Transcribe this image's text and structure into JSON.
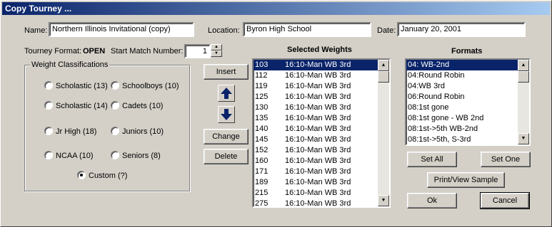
{
  "window": {
    "title": "Copy Tourney ..."
  },
  "header": {
    "name_label": "Name:",
    "name_value": "Northern Illinois Invitational (copy)",
    "location_label": "Location:",
    "location_value": "Byron High School",
    "date_label": "Date:",
    "date_value": "January 20, 2001"
  },
  "format": {
    "label": "Tourney Format:",
    "value": "OPEN",
    "start_label": "Start Match Number:",
    "start_value": "1"
  },
  "weight_group": {
    "title": "Weight Classifications",
    "options": [
      "Scholastic (13)",
      "Schoolboys (10)",
      "Scholastic (14)",
      "Cadets (10)",
      "Jr High (18)",
      "Juniors (10)",
      "NCAA (10)",
      "Seniors (8)",
      "Custom (?)"
    ],
    "selected": "Custom (?)"
  },
  "weight_buttons": {
    "insert": "Insert",
    "change": "Change",
    "delete": "Delete"
  },
  "selected_weights": {
    "heading": "Selected Weights",
    "rows": [
      {
        "weight": "103",
        "format": "16:10-Man WB 3rd"
      },
      {
        "weight": "112",
        "format": "16:10-Man WB 3rd"
      },
      {
        "weight": "119",
        "format": "16:10-Man WB 3rd"
      },
      {
        "weight": "125",
        "format": "16:10-Man WB 3rd"
      },
      {
        "weight": "130",
        "format": "16:10-Man WB 3rd"
      },
      {
        "weight": "135",
        "format": "16:10-Man WB 3rd"
      },
      {
        "weight": "140",
        "format": "16:10-Man WB 3rd"
      },
      {
        "weight": "145",
        "format": "16:10-Man WB 3rd"
      },
      {
        "weight": "152",
        "format": "16:10-Man WB 3rd"
      },
      {
        "weight": "160",
        "format": "16:10-Man WB 3rd"
      },
      {
        "weight": "171",
        "format": "16:10-Man WB 3rd"
      },
      {
        "weight": "189",
        "format": "16:10-Man WB 3rd"
      },
      {
        "weight": "215",
        "format": "16:10-Man WB 3rd"
      },
      {
        "weight": "275",
        "format": "16:10-Man WB 3rd"
      }
    ]
  },
  "formats": {
    "heading": "Formats",
    "items": [
      "04: WB-2nd",
      "04:Round Robin",
      "04:WB 3rd",
      "06:Round Robin",
      "08:1st gone",
      "08:1st gone - WB 2nd",
      "08:1st->5th WB-2nd",
      "08:1st->5th, S-3rd"
    ]
  },
  "format_buttons": {
    "set_all": "Set All",
    "set_one": "Set One",
    "print_view": "Print/View Sample"
  },
  "dialog_buttons": {
    "ok": "Ok",
    "cancel": "Cancel"
  },
  "colors": {
    "face": "#d4d0c8",
    "selection": "#0a246a",
    "arrow": "#0a246a"
  }
}
